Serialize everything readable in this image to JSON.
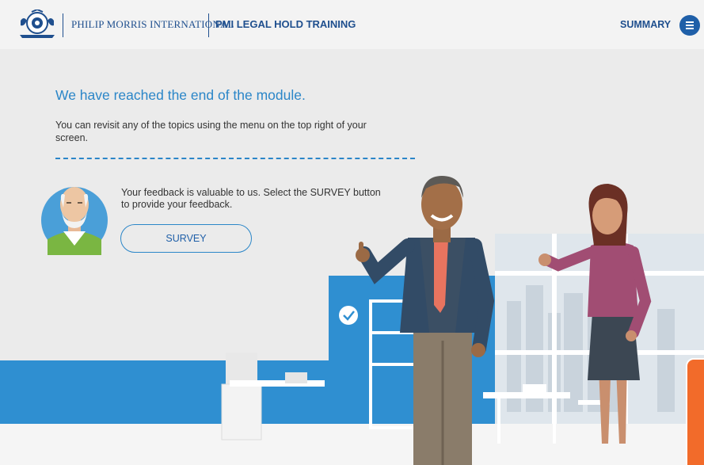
{
  "header": {
    "brand": "PHILIP MORRIS INTERNATIONAL",
    "course_title": "PMI LEGAL HOLD TRAINING",
    "summary_label": "SUMMARY"
  },
  "main": {
    "title": "We have reached the end of the module.",
    "description": "You can revisit any of the topics using the menu on the top right of your screen.",
    "feedback_text": "Your feedback is valuable to us. Select the SURVEY button to provide your feedback.",
    "survey_label": "SURVEY"
  },
  "colors": {
    "brand_blue": "#1f4f8e",
    "accent_blue": "#2b86c8",
    "wall_blue": "#2f8fd1",
    "orange": "#f26b2a"
  },
  "icons": [
    "pmi-crest-logo",
    "menu-icon",
    "clock-icon"
  ]
}
